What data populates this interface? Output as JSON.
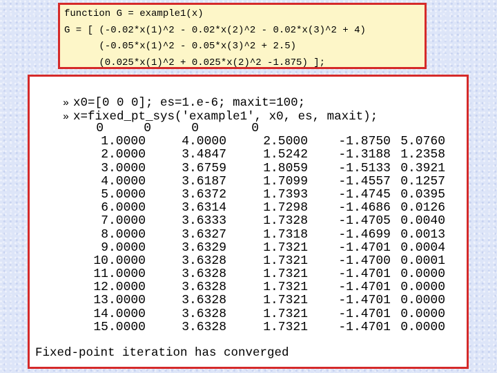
{
  "code": {
    "lines": [
      "function G = example1(x)",
      "G = [ (-0.02*x(1)^2 - 0.02*x(2)^2 - 0.02*x(3)^2 + 4)",
      "      (-0.05*x(1)^2 - 0.05*x(3)^2 + 2.5)",
      "      (0.025*x(1)^2 + 0.025*x(2)^2 -1.875) ];"
    ]
  },
  "console": {
    "prompt": "»",
    "commands": [
      "x0=[0 0 0]; es=1.e-6; maxit=100;",
      "x=fixed_pt_sys('example1', x0, es, maxit);"
    ],
    "header_row": [
      "0",
      "0",
      "0",
      "0"
    ],
    "rows": [
      [
        "1.0000",
        "4.0000",
        "2.5000",
        "-1.8750",
        "5.0760"
      ],
      [
        "2.0000",
        "3.4847",
        "1.5242",
        "-1.3188",
        "1.2358"
      ],
      [
        "3.0000",
        "3.6759",
        "1.8059",
        "-1.5133",
        "0.3921"
      ],
      [
        "4.0000",
        "3.6187",
        "1.7099",
        "-1.4557",
        "0.1257"
      ],
      [
        "5.0000",
        "3.6372",
        "1.7393",
        "-1.4745",
        "0.0395"
      ],
      [
        "6.0000",
        "3.6314",
        "1.7298",
        "-1.4686",
        "0.0126"
      ],
      [
        "7.0000",
        "3.6333",
        "1.7328",
        "-1.4705",
        "0.0040"
      ],
      [
        "8.0000",
        "3.6327",
        "1.7318",
        "-1.4699",
        "0.0013"
      ],
      [
        "9.0000",
        "3.6329",
        "1.7321",
        "-1.4701",
        "0.0004"
      ],
      [
        "10.0000",
        "3.6328",
        "1.7321",
        "-1.4700",
        "0.0001"
      ],
      [
        "11.0000",
        "3.6328",
        "1.7321",
        "-1.4701",
        "0.0000"
      ],
      [
        "12.0000",
        "3.6328",
        "1.7321",
        "-1.4701",
        "0.0000"
      ],
      [
        "13.0000",
        "3.6328",
        "1.7321",
        "-1.4701",
        "0.0000"
      ],
      [
        "14.0000",
        "3.6328",
        "1.7321",
        "-1.4701",
        "0.0000"
      ],
      [
        "15.0000",
        "3.6328",
        "1.7321",
        "-1.4701",
        "0.0000"
      ]
    ],
    "message": "Fixed-point iteration has converged"
  },
  "colors": {
    "border": "#d52a2a",
    "code_background": "#fdf6c8",
    "console_background": "#ffffff",
    "page_background": "#dde5f8"
  }
}
